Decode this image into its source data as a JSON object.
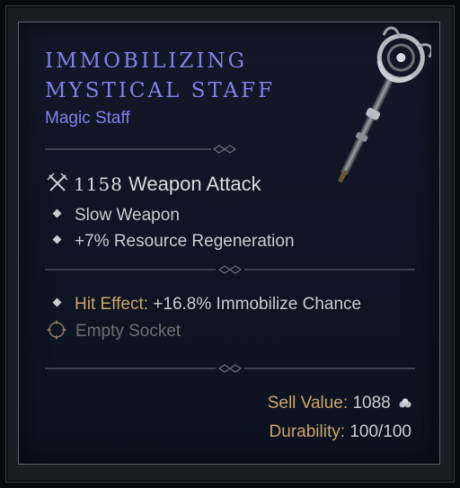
{
  "item": {
    "title_line1": "IMMOBILIZING",
    "title_line2": "MYSTICAL STAFF",
    "type": "Magic Staff",
    "attack_value": "1158",
    "attack_label": "Weapon Attack",
    "properties": [
      "Slow Weapon",
      "+7% Resource Regeneration"
    ],
    "hit_effect_label": "Hit Effect:",
    "hit_effect_value": "+16.8% Immobilize Chance",
    "socket": "Empty Socket",
    "sell_label": "Sell Value:",
    "sell_value": "1088",
    "durability_label": "Durability:",
    "durability_value": "100/100"
  },
  "icons": {
    "attack": "crossed-swords-icon",
    "bullet": "diamond-bullet-icon",
    "socket": "empty-socket-icon",
    "gold": "gold-coin-icon",
    "item_image": "staff-icon"
  },
  "colors": {
    "title": "#7f82ea",
    "gold_label": "#c9a56a",
    "text": "#c9ccd2",
    "socket_text": "#6e6f72"
  }
}
